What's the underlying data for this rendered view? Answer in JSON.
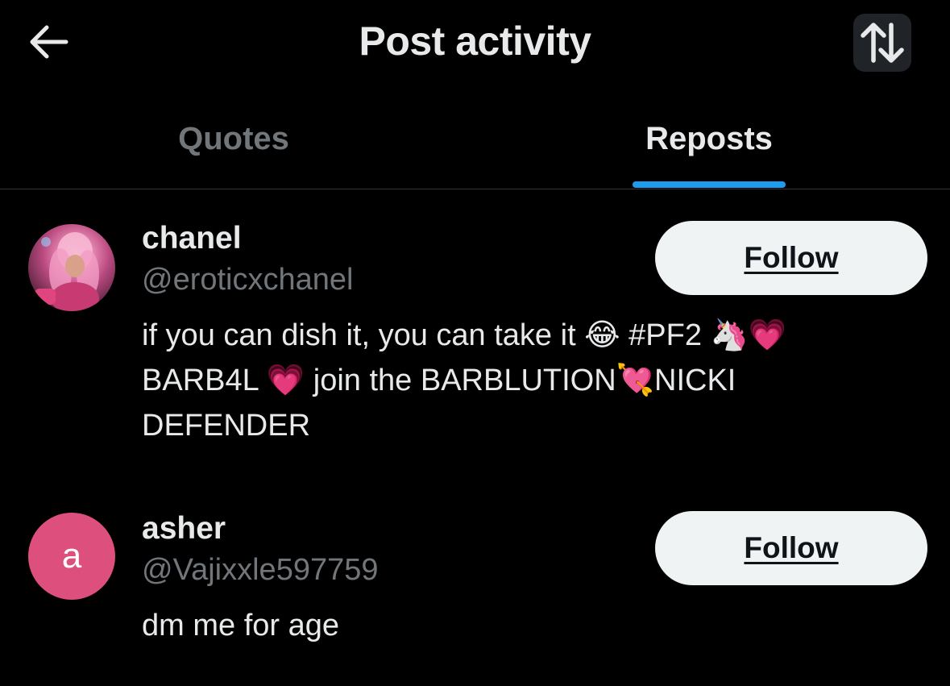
{
  "header": {
    "title": "Post activity",
    "back_icon": "arrow-left-icon",
    "sort_icon": "sort-arrows-icon"
  },
  "tabs": [
    {
      "label": "Quotes",
      "active": false
    },
    {
      "label": "Reposts",
      "active": true
    }
  ],
  "colors": {
    "background": "#000000",
    "accent": "#1d9bf0",
    "primary_text": "#e7e9ea",
    "secondary_text": "#71767b",
    "follow_button_bg": "#eff3f4",
    "letter_avatar_bg": "#dd4f7c"
  },
  "users": [
    {
      "name": "chanel",
      "handle": "@eroticxchanel",
      "avatar_type": "photo",
      "bio": "if you can dish it, you can take it 😂 #PF2 🦄💗 BARB4L 💗 join the BARBLUTION💘NICKI DEFENDER",
      "follow_label": "Follow"
    },
    {
      "name": "asher",
      "handle": "@Vajixxle597759",
      "avatar_type": "letter",
      "avatar_letter": "a",
      "bio": "dm me for age",
      "follow_label": "Follow"
    }
  ]
}
